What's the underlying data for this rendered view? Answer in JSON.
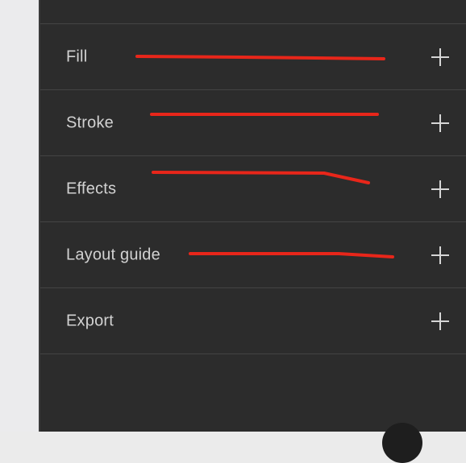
{
  "sections": [
    {
      "label": "Fill",
      "action_icon": "plus-icon"
    },
    {
      "label": "Stroke",
      "action_icon": "plus-icon"
    },
    {
      "label": "Effects",
      "action_icon": "plus-icon"
    },
    {
      "label": "Layout guide",
      "action_icon": "plus-icon"
    },
    {
      "label": "Export",
      "action_icon": "plus-icon"
    }
  ],
  "colors": {
    "panel_background": "#2c2c2c",
    "divider": "#444444",
    "label_text": "#d2d2d2",
    "annotation_stroke": "#e8261a",
    "canvas_background": "#ebebed"
  }
}
